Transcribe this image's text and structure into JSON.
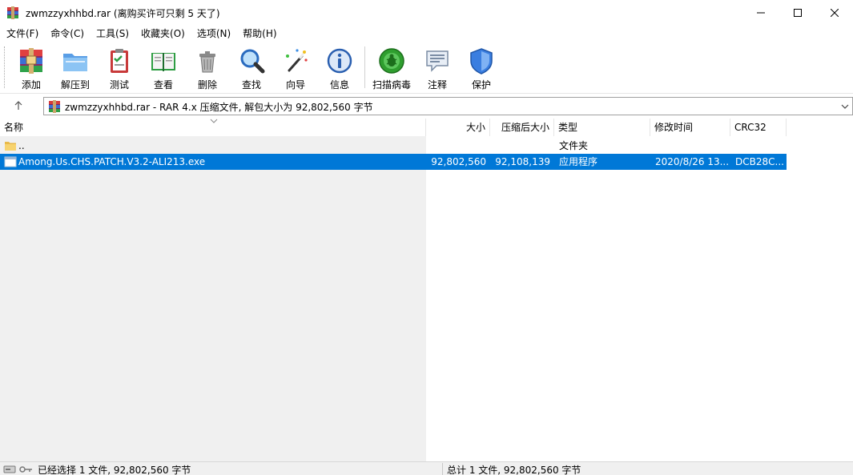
{
  "window": {
    "title": "zwmzzyxhhbd.rar (离购买许可只剩 5 天了)"
  },
  "menu": [
    "文件(F)",
    "命令(C)",
    "工具(S)",
    "收藏夹(O)",
    "选项(N)",
    "帮助(H)"
  ],
  "toolbar": {
    "add": "添加",
    "extract": "解压到",
    "test": "测试",
    "view": "查看",
    "delete": "删除",
    "find": "查找",
    "wizard": "向导",
    "info": "信息",
    "scan": "扫描病毒",
    "comment": "注释",
    "protect": "保护"
  },
  "address": {
    "text": "zwmzzyxhhbd.rar - RAR 4.x 压缩文件, 解包大小为 92,802,560 字节"
  },
  "columns": {
    "name": "名称",
    "size": "大小",
    "packed": "压缩后大小",
    "type": "类型",
    "modified": "修改时间",
    "crc": "CRC32"
  },
  "rows": [
    {
      "name": "..",
      "size": "",
      "packed": "",
      "type": "文件夹",
      "modified": "",
      "crc": ""
    },
    {
      "name": "Among.Us.CHS.PATCH.V3.2-ALI213.exe",
      "size": "92,802,560",
      "packed": "92,108,139",
      "type": "应用程序",
      "modified": "2020/8/26 13...",
      "crc": "DCB28C..."
    }
  ],
  "status": {
    "left": "已经选择 1 文件, 92,802,560 字节",
    "right": "总计 1 文件, 92,802,560 字节"
  },
  "colors": {
    "selection": "#0078d7"
  }
}
